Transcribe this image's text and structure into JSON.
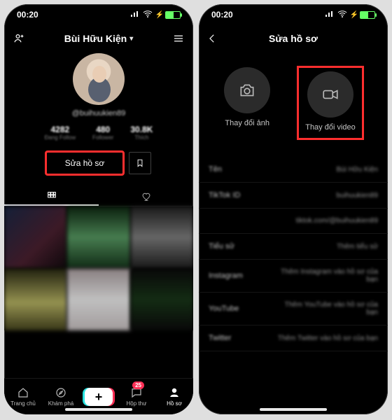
{
  "status": {
    "time": "00:20"
  },
  "left": {
    "header": {
      "username": "Bùi Hữu Kiện"
    },
    "profile": {
      "handle": "@buihuukien89",
      "stats": [
        {
          "num": "4282",
          "label": "Đang Follow"
        },
        {
          "num": "480",
          "label": "Follower"
        },
        {
          "num": "30.8K",
          "label": "Thích"
        }
      ],
      "edit_label": "Sửa hồ sơ"
    },
    "tabbar": {
      "home": "Trang chủ",
      "discover": "Khám phá",
      "inbox": "Hộp thư",
      "profile": "Hồ sơ",
      "inbox_badge": "25"
    }
  },
  "right": {
    "title": "Sửa hồ sơ",
    "media": {
      "photo_label": "Thay đổi ảnh",
      "video_label": "Thay đổi video"
    },
    "rows": [
      {
        "k": "Tên",
        "v": "Bùi Hữu Kiện"
      },
      {
        "k": "TikTok ID",
        "v": "buihuukien89"
      },
      {
        "k": "",
        "v": "tiktok.com/@buihuukien89"
      },
      {
        "k": "Tiểu sử",
        "v": "Thêm tiểu sử"
      },
      {
        "k": "Instagram",
        "v": "Thêm Instagram vào hồ sơ của bạn"
      },
      {
        "k": "YouTube",
        "v": "Thêm YouTube vào hồ sơ của bạn"
      },
      {
        "k": "Twitter",
        "v": "Thêm Twitter vào hồ sơ của bạn"
      }
    ]
  }
}
